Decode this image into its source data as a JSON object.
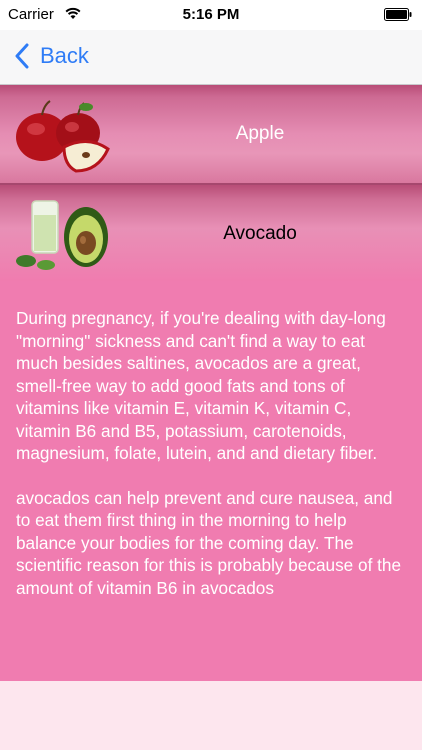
{
  "status_bar": {
    "carrier": "Carrier",
    "time": "5:16 PM"
  },
  "nav": {
    "back_label": "Back"
  },
  "rows": [
    {
      "title": "Apple",
      "icon": "apple-icon"
    },
    {
      "title": "Avocado",
      "icon": "avocado-icon"
    }
  ],
  "detail": {
    "paragraph1": "During pregnancy, if you're dealing with day-long \"morning\" sickness and can't find a way to eat much besides saltines, avocados are a great, smell-free way to add good fats and tons of vitamins like vitamin E, vitamin K, vitamin C, vitamin B6 and B5, potassium, carotenoids, magnesium, folate, lutein, and and dietary fiber.",
    "paragraph2": "avocados can help prevent and cure nausea, and to eat them first thing in the morning to help balance your bodies for the coming day. The scientific reason for this is probably because of the amount of vitamin B6 in avocados"
  },
  "colors": {
    "accent": "#2f7cf6",
    "row_pink": "#e58db3",
    "detail_pink": "#f07cb0",
    "background": "#fde6ee"
  }
}
